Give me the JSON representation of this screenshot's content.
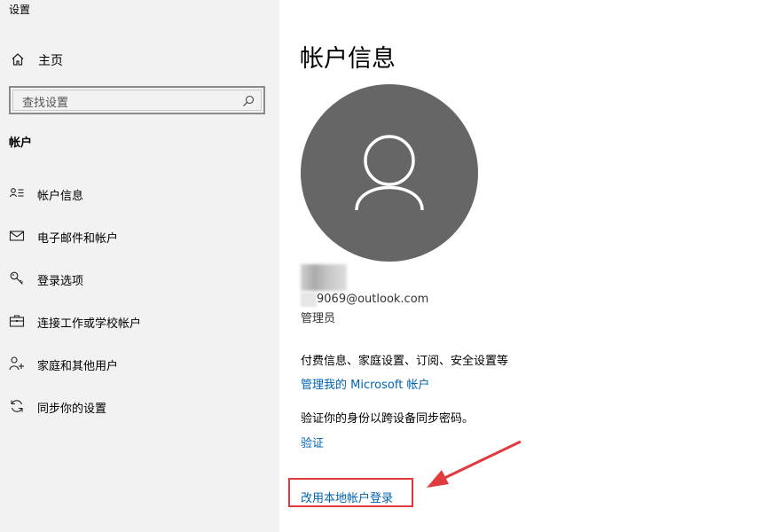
{
  "window": {
    "title": "设置"
  },
  "sidebar": {
    "home_label": "主页",
    "search": {
      "placeholder": "查找设置"
    },
    "section_title": "帐户",
    "items": [
      {
        "label": "帐户信息",
        "icon": "account-info-icon"
      },
      {
        "label": "电子邮件和帐户",
        "icon": "mail-icon"
      },
      {
        "label": "登录选项",
        "icon": "key-icon"
      },
      {
        "label": "连接工作或学校帐户",
        "icon": "briefcase-icon"
      },
      {
        "label": "家庭和其他用户",
        "icon": "add-person-icon"
      },
      {
        "label": "同步你的设置",
        "icon": "sync-icon"
      }
    ]
  },
  "main": {
    "page_title": "帐户信息",
    "email": "9069@outlook.com",
    "role": "管理员",
    "billing_text": "付费信息、家庭设置、订阅、安全设置等",
    "manage_link": "管理我的 Microsoft 帐户",
    "verify_text": "验证你的身份以跨设备同步密码。",
    "verify_link": "验证",
    "local_account_link": "改用本地帐户登录"
  },
  "colors": {
    "sidebar_bg": "#f2f2f2",
    "avatar_bg": "#666666",
    "link": "#0063b1",
    "annotation": "#e0393e"
  }
}
